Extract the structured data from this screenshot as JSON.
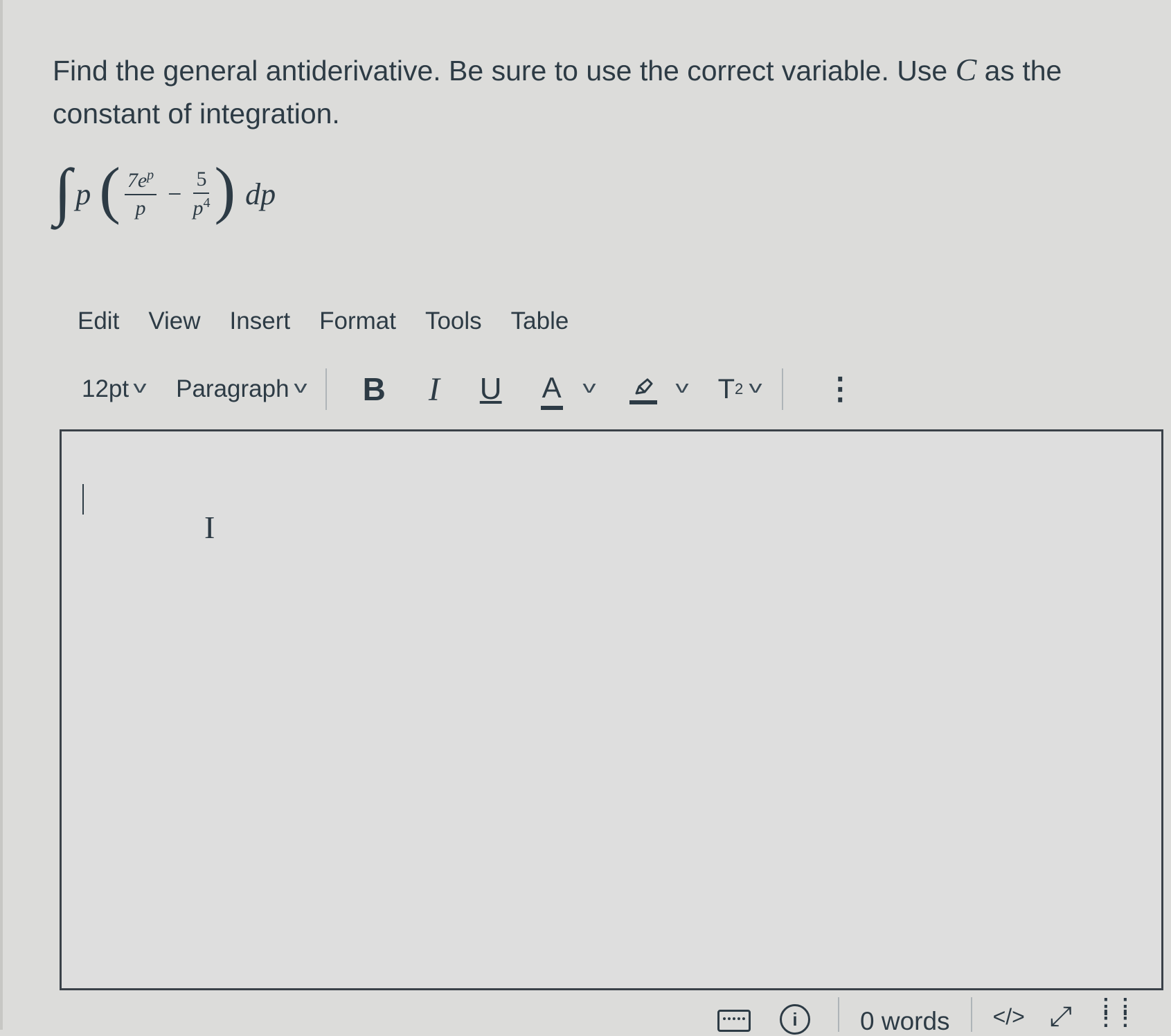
{
  "question": {
    "text_before": "Find the general antiderivative. Be sure to use the correct variable. Use ",
    "constant_var": "C",
    "text_after": " as the constant of integration."
  },
  "integral": {
    "symbol": "∫",
    "factor": "p",
    "open_paren": "(",
    "frac1_num_coef": "7e",
    "frac1_num_exp": "p",
    "frac1_den": "p",
    "minus": "−",
    "frac2_num": "5",
    "frac2_den_base": "p",
    "frac2_den_exp": "4",
    "close_paren": ")",
    "differential": "dp"
  },
  "menubar": {
    "edit": "Edit",
    "view": "View",
    "insert": "Insert",
    "format": "Format",
    "tools": "Tools",
    "table": "Table"
  },
  "toolbar": {
    "font_size": "12pt",
    "block_format": "Paragraph",
    "bold": "B",
    "italic": "I",
    "underline": "U",
    "text_color": "A",
    "superscript_base": "T",
    "superscript_exp": "2",
    "more": "⋮",
    "icons": [
      "chevron-down-icon",
      "highlighter-icon",
      "more-options-icon"
    ]
  },
  "editor": {
    "content": ""
  },
  "statusbar": {
    "word_count": "0 words",
    "html_editor": "</>",
    "expand": "⤢",
    "icons": [
      "keyboard-icon",
      "accessibility-icon",
      "expand-icon",
      "drag-handle-icon"
    ]
  }
}
